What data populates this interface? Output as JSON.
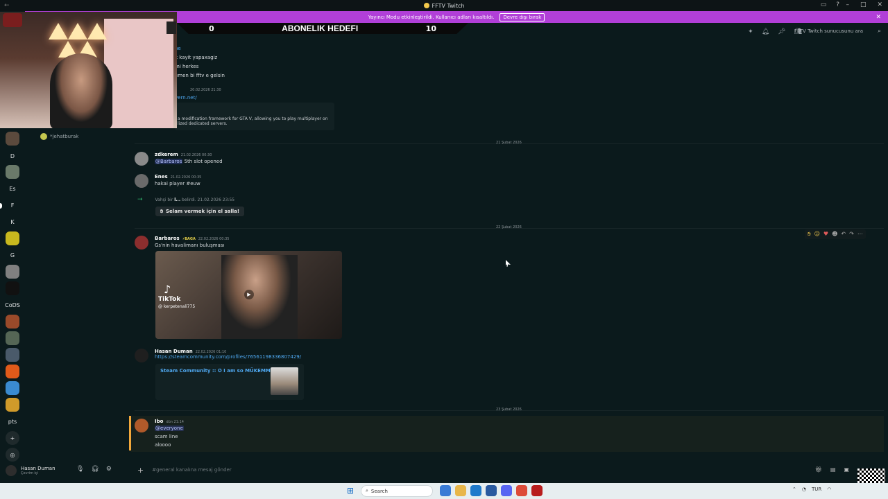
{
  "window": {
    "title": "FFTV Twitch"
  },
  "banner": {
    "text": "Yayıncı Modu etkinleştirildi. Kullanıcı adları kısaltıldı.",
    "button": "Devre dışı bırak"
  },
  "goal": {
    "left_value": "0",
    "title": "ABONELIK HEDEFI",
    "right_value": "10"
  },
  "header": {
    "search_placeholder": "FFTV Twitch sunucusunu ara"
  },
  "servers": [
    "D",
    "Es",
    "F",
    "K",
    "G",
    "CoDS",
    "pts"
  ],
  "voice": {
    "user": "*jehatburak"
  },
  "old_messages": {
    "lines": [
      "ne",
      "k kayit yapaxagiz",
      "mi herkes",
      "emen bi fftv e gelsin"
    ],
    "timestamp": "20.02.2026 21:30",
    "link": "vern.net/",
    "embed_text": "a modification framework for GTA V, allowing you to play multiplayer on",
    "embed_text2": "lized dedicated servers."
  },
  "dividers": {
    "d1": "21 Şubat 2026",
    "d2": "22 Şubat 2026",
    "d3": "23 Şubat 2026"
  },
  "messages": {
    "m1": {
      "author": "zdkerem",
      "timestamp": "21.02.2026 00:30",
      "mention": "@Barbaros",
      "text": " 5th slot opened"
    },
    "m2": {
      "author": "Enes",
      "timestamp": "21.02.2026 00:35",
      "text": "hakai player #euw"
    },
    "system": {
      "text_prefix": "Vahşi bir ",
      "name": "l...",
      "text_suffix": " belirdi.",
      "timestamp": "21.02.2026 23:55",
      "wave": "Selam vermek için el salla!"
    },
    "m3": {
      "author": "Barbaros",
      "badge": "BAGA",
      "timestamp": "22.02.2026 00:35",
      "text": "Gs'nin havalimanı buluşması",
      "video_brand": "TikTok",
      "video_handle": "@ kerpetenali775"
    },
    "m4": {
      "author": "Hasan Duman",
      "timestamp": "22.02.2026 01:10",
      "link": "https://steamcommunity.com/profiles/76561198336807429/",
      "embed_title": "Steam Community :: ✪ I am so MÜKEMMEL"
    },
    "m5": {
      "author": "Ibo",
      "timestamp": "dün 21:14",
      "mention": "@everyone",
      "line1": "scam line",
      "line2": "aloooo"
    }
  },
  "user_panel": {
    "name": "Hasan Duman",
    "status": "Çevrim içi"
  },
  "composer": {
    "placeholder": "#general kanalına mesaj gönder"
  },
  "taskbar": {
    "search": "Search",
    "lang": "TUR"
  }
}
